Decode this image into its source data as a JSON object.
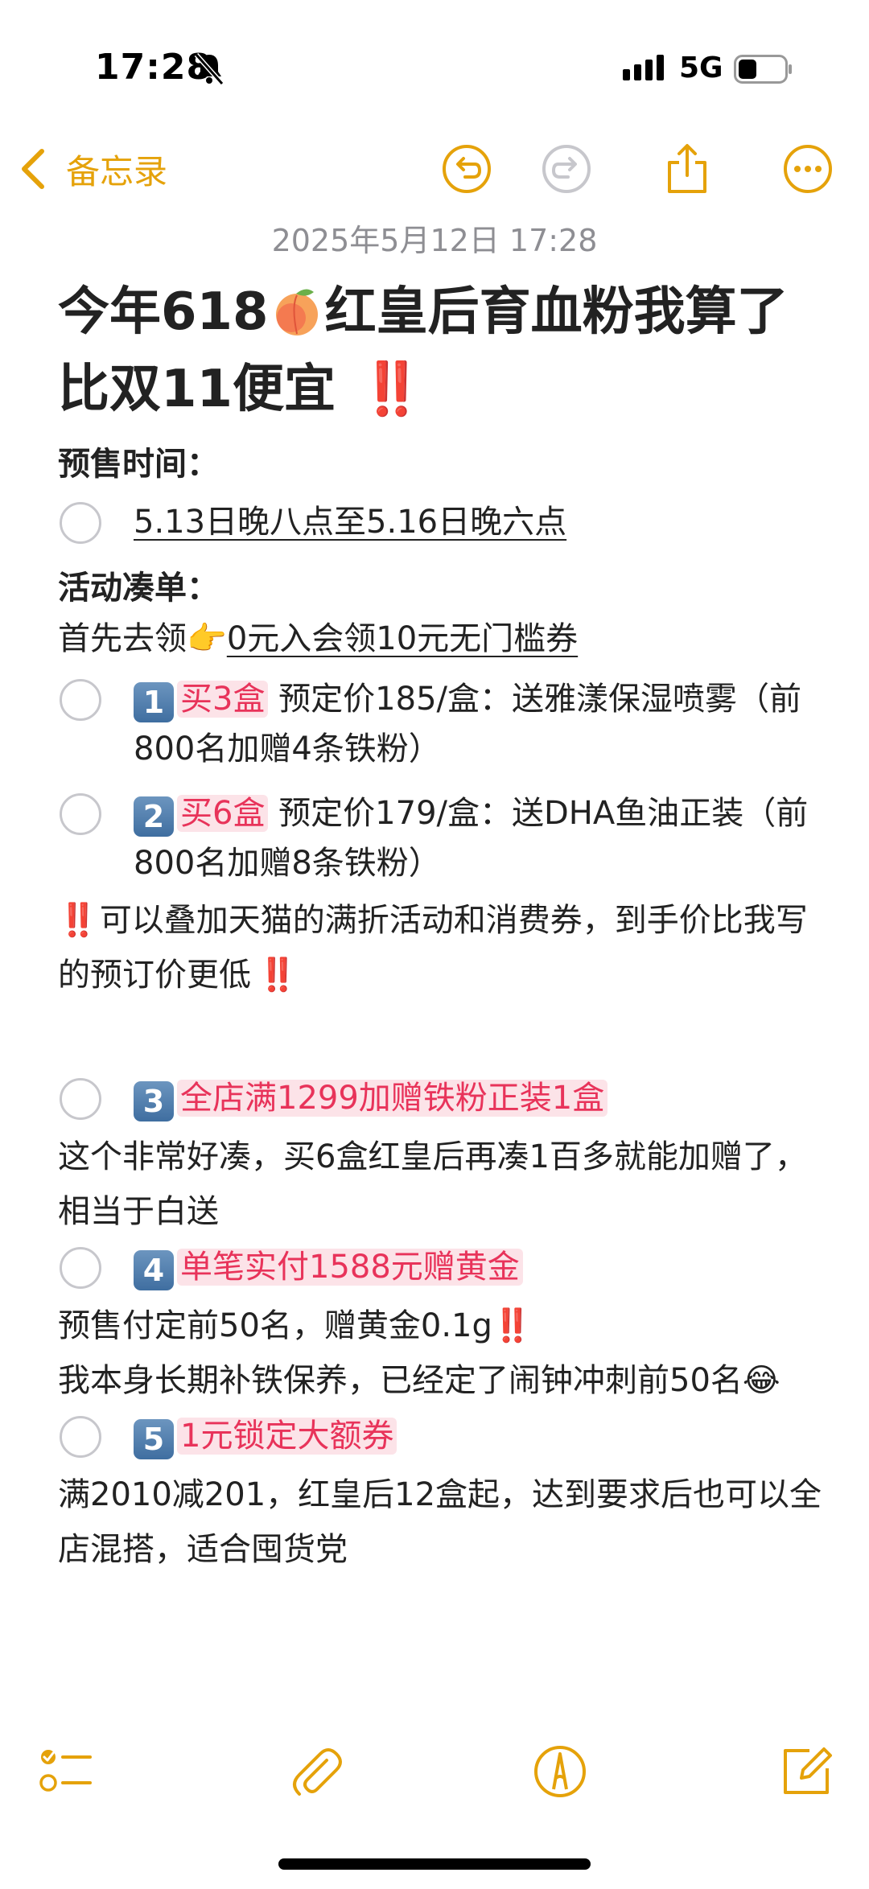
{
  "status_bar": {
    "time": "17:28",
    "network": "5G"
  },
  "nav": {
    "back_label": "备忘录"
  },
  "note": {
    "date": "2025年5月12日 17:28",
    "title_part1": "今年618",
    "title_part2": "红皇后育血粉我算了比双11便宜",
    "bang": "‼️",
    "presale": {
      "heading": "预售时间：",
      "item": "5.13日晚八点至5.16日晚六点"
    },
    "activity": {
      "heading": "活动凑单：",
      "intro_prefix": "首先去领",
      "intro_pointer": "👉",
      "intro_link": "0元入会领10元无门槛券"
    },
    "items": [
      {
        "key": "1",
        "tag": "买3盒",
        "text": " 预定价185/盒：送雅漾保湿喷雾（前800名加赠4条铁粉）"
      },
      {
        "key": "2",
        "tag": "买6盒",
        "text": " 预定价179/盒：送DHA鱼油正装（前800名加赠8条铁粉）"
      }
    ],
    "notice": "可以叠加天猫的满折活动和消费券，到手价比我写的预订价更低",
    "item3": {
      "key": "3",
      "tag": "全店满1299加赠铁粉正装1盒"
    },
    "para3": "这个非常好凑，买6盒红皇后再凑1百多就能加赠了，相当于白送",
    "item4": {
      "key": "4",
      "tag": "单笔实付1588元赠黄金"
    },
    "para4a": "预售付定前50名，赠黄金0.1g",
    "para4b": "我本身长期补铁保养，已经定了闹钟冲刺前50名",
    "laugh": "😂",
    "item5": {
      "key": "5",
      "tag": "1元锁定大额券"
    },
    "para5": "满2010减201，红皇后12盒起，达到要求后也可以全店混搭，适合囤货党"
  },
  "colors": {
    "accent": "#E5A20A",
    "tag_text": "#E8335A",
    "tag_bg": "#FCE3E8"
  },
  "icons": [
    "undo-icon",
    "redo-icon",
    "share-icon",
    "more-icon",
    "checklist-icon",
    "attachment-icon",
    "markup-icon",
    "compose-icon"
  ]
}
